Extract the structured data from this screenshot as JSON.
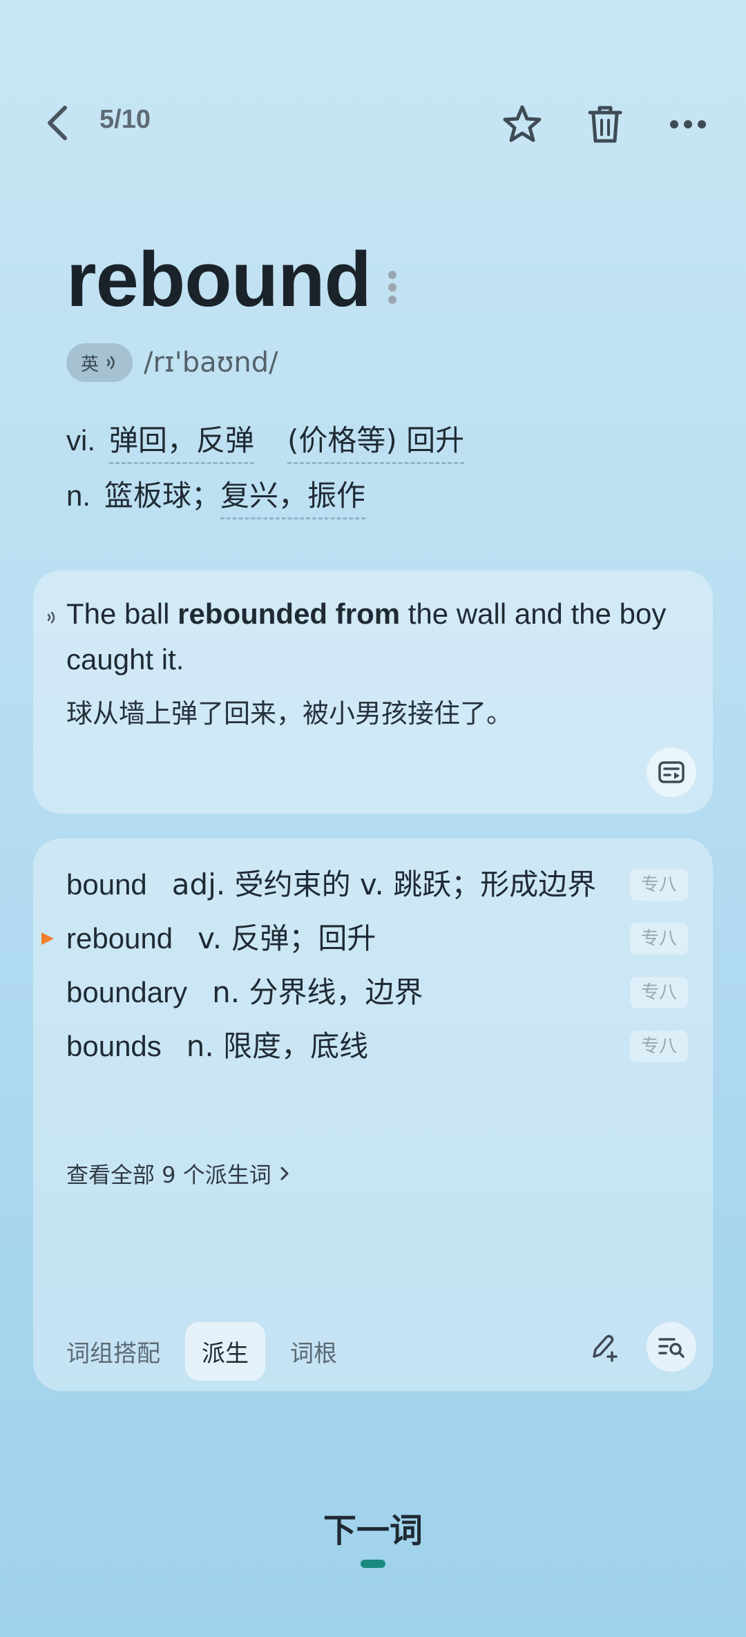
{
  "header": {
    "progress": "5/10",
    "icons": {
      "back": "chevron-left-icon",
      "star": "star-icon",
      "trash": "trash-icon",
      "more": "more-dots-icon"
    }
  },
  "word": {
    "headword": "rebound",
    "accent_label": "英",
    "phonetic": "/rɪ'baʊnd/",
    "definitions": [
      {
        "pos": "vi.",
        "meanings": [
          "弹回，反弹",
          "(价格等) 回升"
        ]
      },
      {
        "pos": "n.",
        "prefix": "篮板球；",
        "meanings": [
          "复兴，振作"
        ]
      }
    ]
  },
  "example": {
    "en_before": "The ball ",
    "en_bold": "rebounded from",
    "en_after": " the wall and the boy caught it.",
    "zh": "球从墙上弹了回来，被小男孩接住了。"
  },
  "derivatives": {
    "items": [
      {
        "word": "bound",
        "meaning": "adj. 受约束的 v. 跳跃；形成边界",
        "tag": "专八",
        "current": false
      },
      {
        "word": "rebound",
        "meaning": "v. 反弹；回升",
        "tag": "专八",
        "current": true
      },
      {
        "word": "boundary",
        "meaning": "n. 分界线，边界",
        "tag": "专八",
        "current": false
      },
      {
        "word": "bounds",
        "meaning": "n. 限度，底线",
        "tag": "专八",
        "current": false
      }
    ],
    "view_all": "查看全部 9 个派生词"
  },
  "tabs": [
    {
      "label": "词组搭配",
      "active": false
    },
    {
      "label": "派生",
      "active": true
    },
    {
      "label": "词根",
      "active": false
    }
  ],
  "footer": {
    "next_label": "下一词"
  },
  "colors": {
    "accent": "#1a8a80",
    "marker": "#f07d2a"
  }
}
